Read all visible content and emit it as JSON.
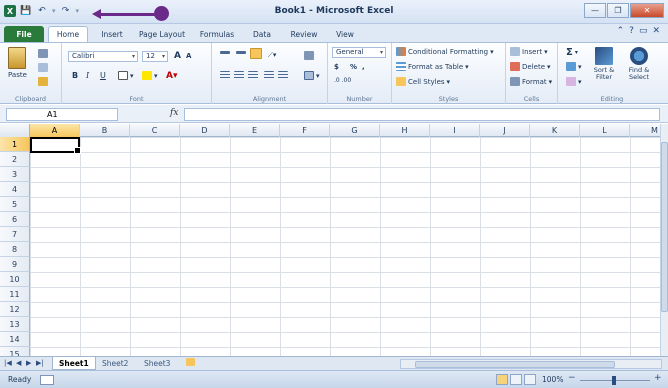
{
  "window": {
    "title": "Book1 - Microsoft Excel",
    "app_logo": "X",
    "qat": {
      "save_icon": "💾",
      "undo_icon": "↶",
      "redo_icon": "↷",
      "customize_icon": "▾"
    },
    "controls": {
      "minimize": "—",
      "maximize": "❐",
      "close": "✕"
    }
  },
  "annotation": {
    "color": "#6b2a8a"
  },
  "ribbon": {
    "tabs": [
      "File",
      "Home",
      "Insert",
      "Page Layout",
      "Formulas",
      "Data",
      "Review",
      "View"
    ],
    "active_tab": "Home",
    "right_icons": {
      "minimize_ribbon": "⌃",
      "help": "?",
      "min_window": "▭",
      "close_window": "✕"
    },
    "clipboard": {
      "paste": "Paste",
      "label": "Clipboard"
    },
    "font": {
      "name": "Calibri",
      "size": "12",
      "grow": "A",
      "shrink": "A",
      "bold": "B",
      "italic": "I",
      "underline": "U",
      "label": "Font"
    },
    "alignment": {
      "label": "Alignment"
    },
    "number": {
      "format": "General",
      "currency": "$",
      "percent": "%",
      "comma": ",",
      "label": "Number"
    },
    "styles": {
      "conditional": "Conditional Formatting",
      "table": "Format as Table",
      "cell_styles": "Cell Styles",
      "label": "Styles"
    },
    "cells": {
      "insert": "Insert",
      "delete": "Delete",
      "format": "Format",
      "label": "Cells"
    },
    "editing": {
      "sum": "Σ",
      "sort": "Sort & Filter",
      "find": "Find & Select",
      "label": "Editing"
    }
  },
  "formula_bar": {
    "name_box": "A1",
    "fx": "fx",
    "value": ""
  },
  "columns": [
    "A",
    "B",
    "C",
    "D",
    "E",
    "F",
    "G",
    "H",
    "I",
    "J",
    "K",
    "L",
    "M"
  ],
  "rows": [
    "1",
    "2",
    "3",
    "4",
    "5",
    "6",
    "7",
    "8",
    "9",
    "10",
    "11",
    "12",
    "13",
    "14",
    "15"
  ],
  "selected_cell": "A1",
  "sheets": {
    "tabs": [
      "Sheet1",
      "Sheet2",
      "Sheet3"
    ],
    "active": "Sheet1",
    "nav": [
      "|◀",
      "◀",
      "▶",
      "▶|"
    ]
  },
  "status": {
    "text": "Ready",
    "zoom": "100%",
    "minus": "−",
    "plus": "+"
  }
}
